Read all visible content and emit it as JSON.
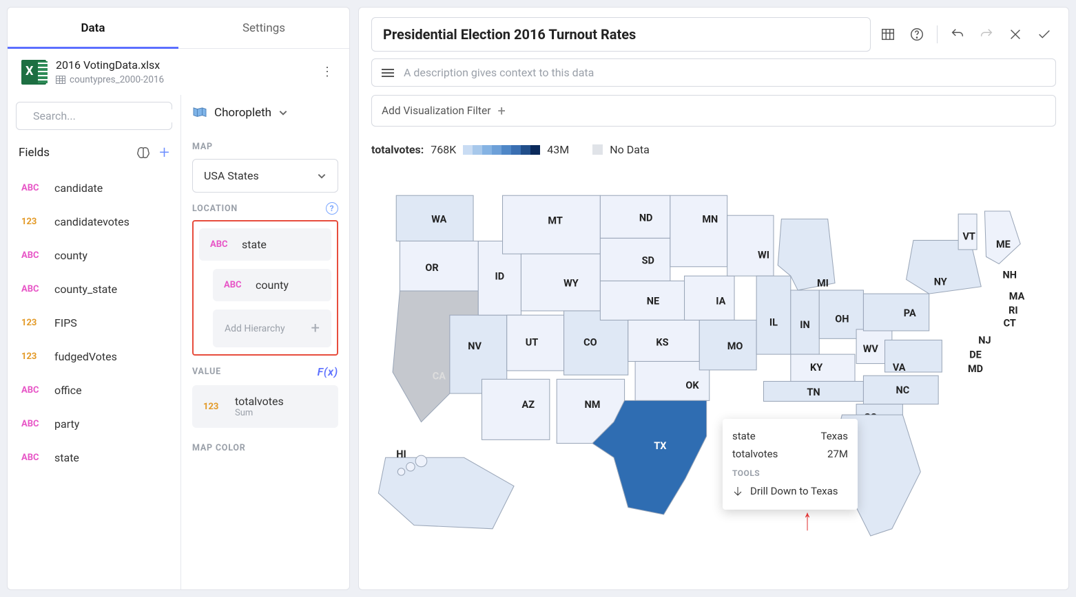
{
  "tabs": {
    "data": "Data",
    "settings": "Settings"
  },
  "datasource": {
    "file": "2016 VotingData.xlsx",
    "table": "countypres_2000-2016"
  },
  "search": {
    "placeholder": "Search..."
  },
  "fieldsHeader": "Fields",
  "fields": [
    {
      "type": "ABC",
      "name": "candidate"
    },
    {
      "type": "123",
      "name": "candidatevotes"
    },
    {
      "type": "ABC",
      "name": "county"
    },
    {
      "type": "ABC",
      "name": "county_state"
    },
    {
      "type": "123",
      "name": "FIPS"
    },
    {
      "type": "123",
      "name": "fudgedVotes"
    },
    {
      "type": "ABC",
      "name": "office"
    },
    {
      "type": "ABC",
      "name": "party"
    },
    {
      "type": "ABC",
      "name": "state"
    }
  ],
  "vizType": "Choropleth",
  "sections": {
    "map": "MAP",
    "location": "LOCATION",
    "value": "VALUE",
    "mapcolor": "MAP COLOR"
  },
  "mapSelect": "USA States",
  "location": {
    "state": {
      "type": "ABC",
      "name": "state"
    },
    "county": {
      "type": "ABC",
      "name": "county"
    },
    "addHierarchy": "Add Hierarchy"
  },
  "value": {
    "type": "123",
    "name": "totalvotes",
    "agg": "Sum"
  },
  "fx": "F(x)",
  "title": "Presidential Election 2016 Turnout Rates",
  "descPlaceholder": "A description gives context to this data",
  "filterBtn": "Add Visualization Filter",
  "legend": {
    "measure": "totalvotes:",
    "min": "768K",
    "max": "43M",
    "nodata": "No Data"
  },
  "gradColors": [
    "#c9dcf3",
    "#a7c8eb",
    "#85b3e3",
    "#6da0d8",
    "#4f87c7",
    "#3a6fb2",
    "#214e8a",
    "#0b2a5b"
  ],
  "states": {
    "WA": "WA",
    "OR": "OR",
    "CA": "CA",
    "NV": "NV",
    "ID": "ID",
    "MT": "MT",
    "WY": "WY",
    "UT": "UT",
    "AZ": "AZ",
    "CO": "CO",
    "NM": "NM",
    "ND": "ND",
    "SD": "SD",
    "NE": "NE",
    "KS": "KS",
    "OK": "OK",
    "TX": "TX",
    "MN": "MN",
    "IA": "IA",
    "MO": "MO",
    "WI": "WI",
    "IL": "IL",
    "IN": "IN",
    "MI": "MI",
    "OH": "OH",
    "KY": "KY",
    "TN": "TN",
    "WV": "WV",
    "VA": "VA",
    "NC": "NC",
    "SC": "SC",
    "PA": "PA",
    "NY": "NY",
    "VT": "VT",
    "NH": "NH",
    "ME": "ME",
    "MA": "MA",
    "RI": "RI",
    "CT": "CT",
    "NJ": "NJ",
    "DE": "DE",
    "MD": "MD",
    "HI": "HI"
  },
  "tooltip": {
    "stateKey": "state",
    "stateVal": "Texas",
    "measureKey": "totalvotes",
    "measureVal": "27M",
    "toolsHdr": "TOOLS",
    "drill": "Drill Down to Texas"
  }
}
